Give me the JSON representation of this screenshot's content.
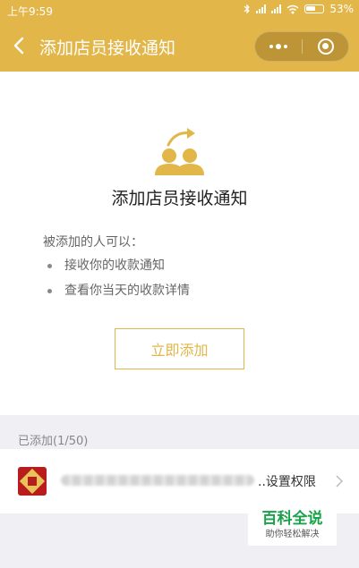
{
  "status_bar": {
    "time": "上午9:59",
    "battery": "53%"
  },
  "nav": {
    "title": "添加店员接收通知"
  },
  "main": {
    "headline": "添加店员接收通知",
    "description": "被添加的人可以：",
    "benefits": [
      "接收你的收款通知",
      "查看你当天的收款详情"
    ],
    "add_button": "立即添加"
  },
  "staff_list": {
    "label": "已添加(1/50)",
    "items": [
      {
        "name_suffix": "..",
        "action": "设置权限"
      }
    ]
  },
  "watermark": {
    "title": "百科全说",
    "subtitle": "助你轻松解决"
  },
  "colors": {
    "accent": "#e2b649",
    "background": "#efeff4"
  }
}
